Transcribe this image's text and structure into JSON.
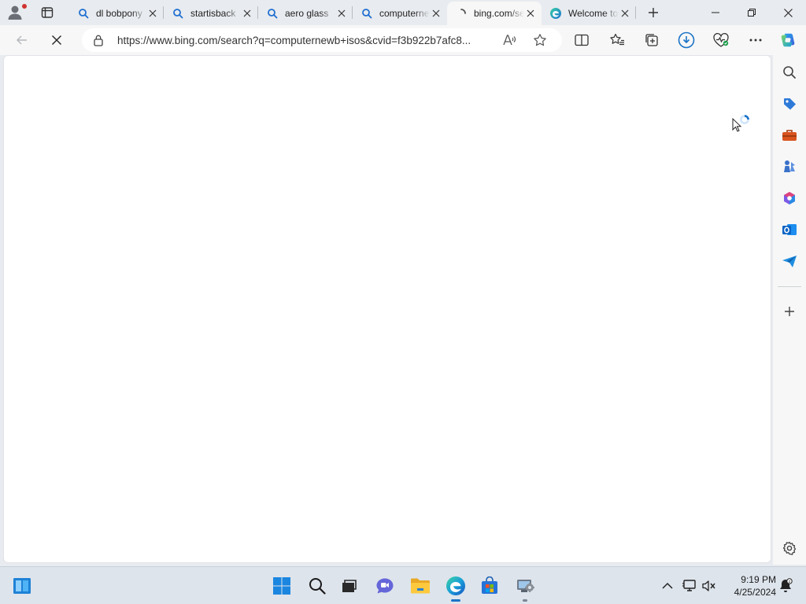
{
  "browser": {
    "tabs": [
      {
        "label": "dl bobpony",
        "icon": "search-icon",
        "loading": false
      },
      {
        "label": "startisback",
        "icon": "search-icon",
        "loading": false
      },
      {
        "label": "aero glass",
        "icon": "search-icon",
        "loading": false
      },
      {
        "label": "computernewb",
        "icon": "search-icon",
        "loading": false
      },
      {
        "label": "bing.com/search",
        "icon": "loading-spinner-icon",
        "loading": true
      },
      {
        "label": "Welcome to Microsoft Edge",
        "icon": "edge-icon",
        "loading": false
      }
    ],
    "active_tab": 4,
    "address": {
      "url": "https://www.bing.com/search?q=computernewb+isos&cvid=f3b922b7afc8..."
    }
  },
  "sidebar": {
    "icons": [
      "search-icon",
      "shopping-tag-icon",
      "tools-icon",
      "games-icon",
      "microsoft-365-icon",
      "outlook-icon",
      "drop-icon",
      "add-icon",
      "settings-icon"
    ]
  },
  "taskbar": {
    "apps": [
      "start-icon",
      "search-icon",
      "task-view-icon",
      "chat-icon",
      "file-explorer-icon",
      "edge-icon",
      "store-icon",
      "system-tool-icon"
    ],
    "clock": {
      "time": "9:19 PM",
      "date": "4/25/2024"
    }
  },
  "colors": {
    "accent": "#1a73c7",
    "tabstrip": "#e8ebef",
    "toolbar": "#f7f7f7",
    "taskbar": "#dde4ec"
  }
}
